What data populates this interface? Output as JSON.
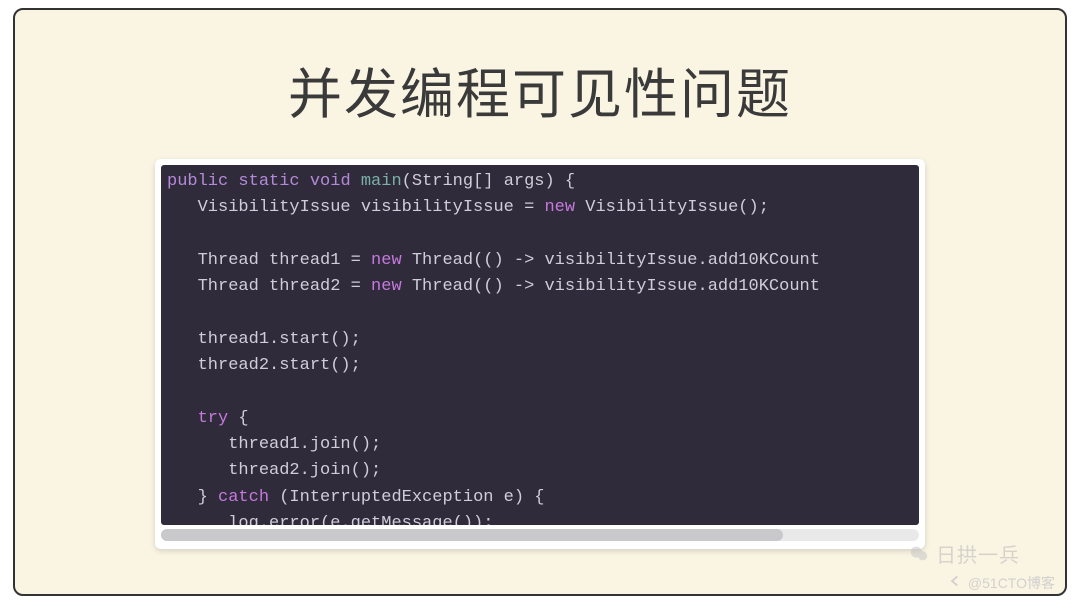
{
  "slide": {
    "title": "并发编程可见性问题"
  },
  "code": {
    "lines": [
      {
        "indent": 0,
        "tokens": [
          {
            "t": "public",
            "c": "kw"
          },
          {
            "t": " ",
            "c": "punc"
          },
          {
            "t": "static",
            "c": "kw"
          },
          {
            "t": " ",
            "c": "punc"
          },
          {
            "t": "void",
            "c": "kw"
          },
          {
            "t": " ",
            "c": "punc"
          },
          {
            "t": "main",
            "c": "fn"
          },
          {
            "t": "(String[] args) {",
            "c": "id"
          }
        ]
      },
      {
        "indent": 1,
        "tokens": [
          {
            "t": "VisibilityIssue visibilityIssue = ",
            "c": "id"
          },
          {
            "t": "new",
            "c": "kw2"
          },
          {
            "t": " VisibilityIssue();",
            "c": "id"
          }
        ]
      },
      {
        "indent": 0,
        "tokens": []
      },
      {
        "indent": 1,
        "tokens": [
          {
            "t": "Thread thread1 = ",
            "c": "id"
          },
          {
            "t": "new",
            "c": "kw2"
          },
          {
            "t": " Thread(() -> visibilityIssue.add10KCount",
            "c": "id"
          }
        ]
      },
      {
        "indent": 1,
        "tokens": [
          {
            "t": "Thread thread2 = ",
            "c": "id"
          },
          {
            "t": "new",
            "c": "kw2"
          },
          {
            "t": " Thread(() -> visibilityIssue.add10KCount",
            "c": "id"
          }
        ]
      },
      {
        "indent": 0,
        "tokens": []
      },
      {
        "indent": 1,
        "tokens": [
          {
            "t": "thread1.start();",
            "c": "id"
          }
        ]
      },
      {
        "indent": 1,
        "tokens": [
          {
            "t": "thread2.start();",
            "c": "id"
          }
        ]
      },
      {
        "indent": 0,
        "tokens": []
      },
      {
        "indent": 1,
        "tokens": [
          {
            "t": "try",
            "c": "kw2"
          },
          {
            "t": " {",
            "c": "id"
          }
        ]
      },
      {
        "indent": 2,
        "tokens": [
          {
            "t": "thread1.join();",
            "c": "id"
          }
        ]
      },
      {
        "indent": 2,
        "tokens": [
          {
            "t": "thread2.join();",
            "c": "id"
          }
        ]
      },
      {
        "indent": 1,
        "tokens": [
          {
            "t": "} ",
            "c": "id"
          },
          {
            "t": "catch",
            "c": "kw2"
          },
          {
            "t": " (InterruptedException e) {",
            "c": "id"
          }
        ]
      },
      {
        "indent": 2,
        "tokens": [
          {
            "t": "log.error(e.getMessage());",
            "c": "id"
          }
        ]
      },
      {
        "indent": 1,
        "tokens": [
          {
            "t": "}",
            "c": "id"
          }
        ]
      }
    ]
  },
  "watermarks": {
    "author": "日拱一兵",
    "platform": "@51CTO博客"
  }
}
